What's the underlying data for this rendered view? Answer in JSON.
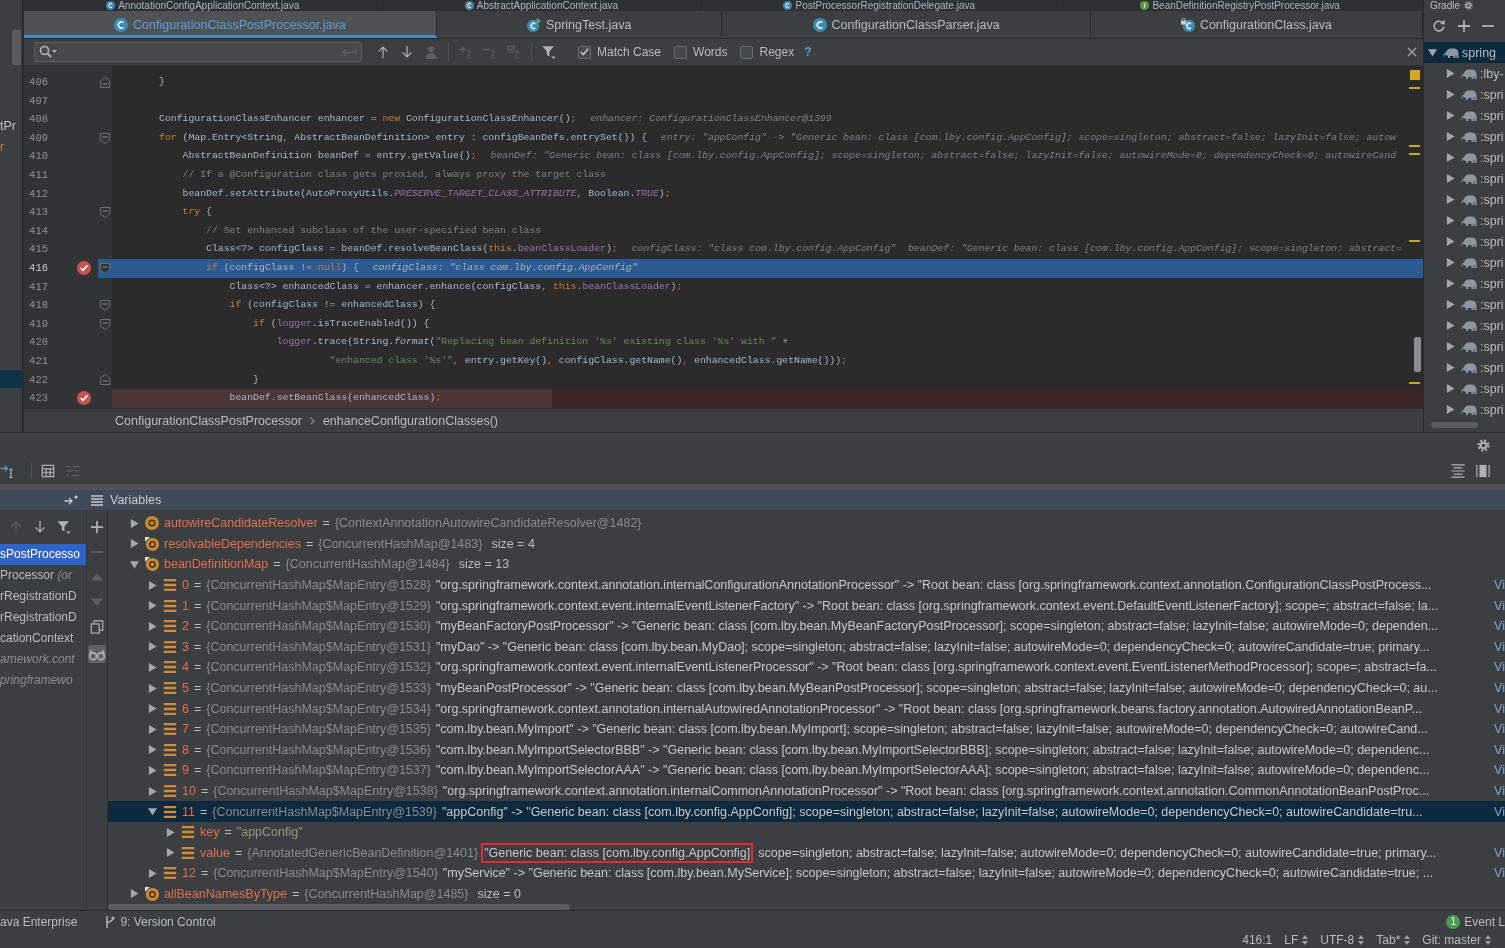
{
  "project_strip": {
    "items": [
      {
        "label": "tPr",
        "color": "#bbbbbb"
      },
      {
        "label": "r",
        "color": "#c47a3c"
      }
    ],
    "selection_visible": true
  },
  "tab_rows": [
    {
      "tabs": [
        {
          "label": "AnnotationConfigApplicationContext.java",
          "kind": "class",
          "selected": false
        },
        {
          "label": "AbstractApplicationContext.java",
          "kind": "abstract_class",
          "selected": false
        },
        {
          "label": "PostProcessorRegistrationDelegate.java",
          "kind": "class",
          "selected": false
        },
        {
          "label": "BeanDefinitionRegistryPostProcessor.java",
          "kind": "interface",
          "selected": false
        }
      ]
    },
    {
      "tabs": [
        {
          "label": "ConfigurationClassPostProcessor.java",
          "kind": "class",
          "selected": true
        },
        {
          "label": "SpringTest.java",
          "kind": "runnable_class",
          "selected": false
        },
        {
          "label": "ConfigurationClassParser.java",
          "kind": "class",
          "selected": false
        },
        {
          "label": "ConfigurationClass.java",
          "kind": "final_class",
          "selected": false
        }
      ]
    }
  ],
  "find_bar": {
    "tools": [
      {
        "kind": "previous",
        "disabled": false
      },
      {
        "kind": "next",
        "disabled": false
      },
      {
        "kind": "person",
        "disabled": true
      },
      {
        "kind": "add_occurrence",
        "disabled": true
      },
      {
        "kind": "remove_occurrence",
        "disabled": true
      },
      {
        "kind": "select_occurrences",
        "disabled": true
      },
      {
        "kind": "filter",
        "disabled": false
      }
    ],
    "options": [
      {
        "label": "Match Case",
        "checked": true
      },
      {
        "label": "Words",
        "checked": false
      },
      {
        "label": "Regex",
        "checked": false
      }
    ],
    "help": "?"
  },
  "editor": {
    "lines": [
      {
        "number": "406",
        "fold": {
          "kind": "end"
        },
        "breakpoint": false,
        "current": false,
        "tokens": [
          {
            "kind": "plain",
            "text": "        }"
          }
        ]
      },
      {
        "number": "407",
        "breakpoint": false,
        "current": false
      },
      {
        "number": "408",
        "breakpoint": false,
        "current": false,
        "tokens": [
          {
            "kind": "plain",
            "text": "        ConfigurationClassEnhancer enhancer = "
          },
          {
            "kind": "keyword",
            "text": "new"
          },
          {
            "kind": "plain",
            "text": " ConfigurationClassEnhancer()"
          },
          {
            "kind": "punct",
            "text": ";"
          }
        ],
        "hint": "enhancer: ConfigurationClassEnhancer@1399"
      },
      {
        "number": "409",
        "fold": {
          "kind": "start"
        },
        "breakpoint": false,
        "current": false,
        "tokens": [
          {
            "kind": "keyword",
            "text": "        for"
          },
          {
            "kind": "plain",
            "text": " (Map.Entry<String"
          },
          {
            "kind": "punct",
            "text": ","
          },
          {
            "kind": "plain",
            "text": " AbstractBeanDefinition> entry : configBeanDefs.entrySet()) {"
          }
        ],
        "hint": "entry: \"appConfig\" -> \"Generic bean: class [com.lby.config.AppConfig]; scope=singleton; abstract=false; lazyInit=false; autow"
      },
      {
        "number": "410",
        "breakpoint": false,
        "current": false,
        "tokens": [
          {
            "kind": "plain",
            "text": "            AbstractBeanDefinition beanDef = entry.getValue()"
          },
          {
            "kind": "punct",
            "text": ";"
          }
        ],
        "hint": "beanDef: \"Generic bean: class [com.lby.config.AppConfig]; scope=singleton; abstract=false; lazyInit=false; autowireMode=0; dependencyCheck=0; autowireCand"
      },
      {
        "number": "411",
        "breakpoint": false,
        "current": false,
        "tokens": [
          {
            "kind": "comment",
            "text": "            // If a @Configuration class gets proxied, always proxy the target class"
          }
        ]
      },
      {
        "number": "412",
        "breakpoint": false,
        "current": false,
        "tokens": [
          {
            "kind": "plain",
            "text": "            beanDef.setAttribute(AutoProxyUtils."
          },
          {
            "kind": "constant",
            "text": "PRESERVE_TARGET_CLASS_ATTRIBUTE"
          },
          {
            "kind": "punct",
            "text": ","
          },
          {
            "kind": "plain",
            "text": " Boolean."
          },
          {
            "kind": "constant",
            "text": "TRUE"
          },
          {
            "kind": "plain",
            "text": ")"
          },
          {
            "kind": "punct",
            "text": ";"
          }
        ]
      },
      {
        "number": "413",
        "fold": {
          "kind": "start"
        },
        "breakpoint": false,
        "current": false,
        "tokens": [
          {
            "kind": "keyword",
            "text": "            try"
          },
          {
            "kind": "plain",
            "text": " {"
          }
        ]
      },
      {
        "number": "414",
        "breakpoint": false,
        "current": false,
        "tokens": [
          {
            "kind": "comment",
            "text": "                // Set enhanced subclass of the user-specified bean class"
          }
        ]
      },
      {
        "number": "415",
        "breakpoint": false,
        "current": false,
        "tokens": [
          {
            "kind": "plain",
            "text": "                Class<?> configClass = beanDef.resolveBeanClass("
          },
          {
            "kind": "keyword",
            "text": "this"
          },
          {
            "kind": "plain",
            "text": "."
          },
          {
            "kind": "field",
            "text": "beanClassLoader"
          },
          {
            "kind": "plain",
            "text": ")"
          },
          {
            "kind": "punct",
            "text": ";"
          }
        ],
        "hint": "configClass: \"class com.lby.config.AppConfig\"  beanDef: \"Generic bean: class [com.lby.config.AppConfig]; scope=singleton; abstract="
      },
      {
        "number": "416",
        "fold": {
          "kind": "start"
        },
        "breakpoint": true,
        "current": true,
        "tokens": [
          {
            "kind": "keyword",
            "text": "                if"
          },
          {
            "kind": "plain",
            "text": " (configClass != "
          },
          {
            "kind": "keyword",
            "text": "null"
          },
          {
            "kind": "plain",
            "text": ") {"
          }
        ],
        "hint": "configClass: \"class com.lby.config.AppConfig\""
      },
      {
        "number": "417",
        "breakpoint": false,
        "current": false,
        "tokens": [
          {
            "kind": "plain",
            "text": "                    Class<?> enhancedClass = enhancer.enhance(configClass"
          },
          {
            "kind": "punct",
            "text": ","
          },
          {
            "kind": "keyword",
            "text": " this"
          },
          {
            "kind": "plain",
            "text": "."
          },
          {
            "kind": "field",
            "text": "beanClassLoader"
          },
          {
            "kind": "plain",
            "text": ")"
          },
          {
            "kind": "punct",
            "text": ";"
          }
        ]
      },
      {
        "number": "418",
        "fold": {
          "kind": "start"
        },
        "breakpoint": false,
        "current": false,
        "tokens": [
          {
            "kind": "keyword",
            "text": "                    if"
          },
          {
            "kind": "plain",
            "text": " (configClass != enhancedClass) {"
          }
        ]
      },
      {
        "number": "419",
        "fold": {
          "kind": "start"
        },
        "breakpoint": false,
        "current": false,
        "tokens": [
          {
            "kind": "keyword",
            "text": "                        if"
          },
          {
            "kind": "plain",
            "text": " ("
          },
          {
            "kind": "field",
            "text": "logger"
          },
          {
            "kind": "plain",
            "text": ".isTraceEnabled()) {"
          }
        ]
      },
      {
        "number": "420",
        "breakpoint": false,
        "current": false,
        "tokens": [
          {
            "kind": "field",
            "text": "                            logger"
          },
          {
            "kind": "plain",
            "text": ".trace(String."
          },
          {
            "kind": "static_method",
            "text": "format"
          },
          {
            "kind": "plain",
            "text": "("
          },
          {
            "kind": "string",
            "text": "\"Replacing bean definition '%s' existing class '%s' with \""
          },
          {
            "kind": "plain",
            "text": " +"
          }
        ]
      },
      {
        "number": "421",
        "breakpoint": false,
        "current": false,
        "tokens": [
          {
            "kind": "string",
            "text": "                                     \"enhanced class '%s'\""
          },
          {
            "kind": "punct",
            "text": ","
          },
          {
            "kind": "plain",
            "text": " entry.getKey()"
          },
          {
            "kind": "punct",
            "text": ","
          },
          {
            "kind": "plain",
            "text": " configClass.getName()"
          },
          {
            "kind": "punct",
            "text": ","
          },
          {
            "kind": "plain",
            "text": " enhancedClass.getName()))"
          },
          {
            "kind": "punct",
            "text": ";"
          }
        ]
      },
      {
        "number": "422",
        "fold": {
          "kind": "end"
        },
        "breakpoint": false,
        "current": false,
        "tokens": [
          {
            "kind": "plain",
            "text": "                        }"
          }
        ]
      },
      {
        "number": "423",
        "breakpoint": true,
        "current": false,
        "tokens": [
          {
            "kind": "plain",
            "text": "                    beanDef.setBeanClass(enhancedClass)"
          },
          {
            "kind": "punct",
            "text": ";"
          }
        ]
      }
    ]
  },
  "breadcrumbs": [
    "ConfigurationClassPostProcessor",
    "enhanceConfigurationClasses()"
  ],
  "gradle": {
    "title": "Gradle",
    "tree": [
      {
        "label": "spring",
        "expanded": true,
        "selected": true,
        "children": [
          {
            "label": ":lby-",
            "expanded": false,
            "selected": false
          },
          {
            "label": ":spri",
            "expanded": false,
            "selected": false
          },
          {
            "label": ":spri",
            "expanded": false,
            "selected": false
          },
          {
            "label": ":spri",
            "expanded": false,
            "selected": false
          },
          {
            "label": ":spri",
            "expanded": false,
            "selected": false
          },
          {
            "label": ":spri",
            "expanded": false,
            "selected": false
          },
          {
            "label": ":spri",
            "expanded": false,
            "selected": false
          },
          {
            "label": ":spri",
            "expanded": false,
            "selected": false
          },
          {
            "label": ":spri",
            "expanded": false,
            "selected": false
          },
          {
            "label": ":spri",
            "expanded": false,
            "selected": false
          },
          {
            "label": ":spri",
            "expanded": false,
            "selected": false
          },
          {
            "label": ":spri",
            "expanded": false,
            "selected": false
          },
          {
            "label": ":spri",
            "expanded": false,
            "selected": false
          },
          {
            "label": ":spri",
            "expanded": false,
            "selected": false
          },
          {
            "label": ":spri",
            "expanded": false,
            "selected": false
          },
          {
            "label": ":spri",
            "expanded": false,
            "selected": false
          },
          {
            "label": ":spri",
            "expanded": false,
            "selected": false
          }
        ]
      }
    ]
  },
  "debug_toolbar": {
    "left": [
      {
        "kind": "run_to_cursor",
        "disabled": false
      },
      {
        "kind": "evaluate",
        "disabled": false
      },
      {
        "kind": "trace",
        "disabled": true
      }
    ],
    "right": [
      {
        "kind": "align",
        "disabled": false
      },
      {
        "kind": "columns",
        "disabled": false
      }
    ]
  },
  "frames": {
    "toolbar": [
      {
        "kind": "up",
        "disabled": true
      },
      {
        "kind": "down",
        "disabled": false
      },
      {
        "kind": "filter",
        "disabled": false
      }
    ],
    "items": [
      {
        "method": "sPostProcesso",
        "selected": true
      },
      {
        "method": "Processor",
        "location": "(or",
        "selected": false
      },
      {
        "method": "rRegistrationD",
        "selected": false
      },
      {
        "method": "rRegistrationD",
        "selected": false
      },
      {
        "method": "cationContext",
        "selected": false
      },
      {
        "location": "amework.cont",
        "selected": false
      },
      {
        "location": "pringframewo",
        "selected": false
      }
    ]
  },
  "side_toolbar": [
    {
      "kind": "add",
      "disabled": false,
      "on": false
    },
    {
      "kind": "remove",
      "disabled": true,
      "on": false
    },
    {
      "kind": "move_up",
      "disabled": true,
      "on": false
    },
    {
      "kind": "move_down",
      "disabled": true,
      "on": false
    },
    {
      "kind": "copy",
      "disabled": false,
      "on": false
    },
    {
      "kind": "glasses",
      "disabled": false,
      "on": true
    }
  ],
  "variables": {
    "title": "Variables",
    "tree": [
      {
        "name": "autowireCandidateResolver",
        "kind": "field",
        "equals": "=",
        "ref": "{ContextAnnotationAutowireCandidateResolver@1482}",
        "expanded": false,
        "selected": false
      },
      {
        "name": "resolvableDependencies",
        "kind": "final_field",
        "equals": "=",
        "ref": "{ConcurrentHashMap@1483}",
        "size": "size = 4",
        "expanded": false,
        "selected": false
      },
      {
        "name": "beanDefinitionMap",
        "kind": "final_field",
        "equals": "=",
        "ref": "{ConcurrentHashMap@1484}",
        "size": "size = 13",
        "expanded": true,
        "selected": false,
        "children": [
          {
            "name": "0",
            "kind": "entry",
            "equals": "=",
            "ref": "{ConcurrentHashMap$MapEntry@1528}",
            "value": "\"org.springframework.context.annotation.internalConfigurationAnnotationProcessor\" -> \"Root bean: class [org.springframework.context.annotation.ConfigurationClassPostProcess...",
            "link": "Vi",
            "expanded": false,
            "selected": false
          },
          {
            "name": "1",
            "kind": "entry",
            "equals": "=",
            "ref": "{ConcurrentHashMap$MapEntry@1529}",
            "value": "\"org.springframework.context.event.internalEventListenerFactory\" -> \"Root bean: class [org.springframework.context.event.DefaultEventListenerFactory]; scope=; abstract=false; la...",
            "link": "Vi",
            "expanded": false,
            "selected": false
          },
          {
            "name": "2",
            "kind": "entry",
            "equals": "=",
            "ref": "{ConcurrentHashMap$MapEntry@1530}",
            "value": "\"myBeanFactoryPostProcessor\" -> \"Generic bean: class [com.lby.bean.MyBeanFactoryPostProcessor]; scope=singleton; abstract=false; lazyInit=false; autowireMode=0; dependen...",
            "link": "Vi",
            "expanded": false,
            "selected": false
          },
          {
            "name": "3",
            "kind": "entry",
            "equals": "=",
            "ref": "{ConcurrentHashMap$MapEntry@1531}",
            "value": "\"myDao\" -> \"Generic bean: class [com.lby.bean.MyDao]; scope=singleton; abstract=false; lazyInit=false; autowireMode=0; dependencyCheck=0; autowireCandidate=true; primary...",
            "link": "Vi",
            "expanded": false,
            "selected": false
          },
          {
            "name": "4",
            "kind": "entry",
            "equals": "=",
            "ref": "{ConcurrentHashMap$MapEntry@1532}",
            "value": "\"org.springframework.context.event.internalEventListenerProcessor\" -> \"Root bean: class [org.springframework.context.event.EventListenerMethodProcessor]; scope=; abstract=fa...",
            "link": "Vi",
            "expanded": false,
            "selected": false
          },
          {
            "name": "5",
            "kind": "entry",
            "equals": "=",
            "ref": "{ConcurrentHashMap$MapEntry@1533}",
            "value": "\"myBeanPostProcessor\" -> \"Generic bean: class [com.lby.bean.MyBeanPostProcessor]; scope=singleton; abstract=false; lazyInit=false; autowireMode=0; dependencyCheck=0; au...",
            "link": "Vi",
            "expanded": false,
            "selected": false
          },
          {
            "name": "6",
            "kind": "entry",
            "equals": "=",
            "ref": "{ConcurrentHashMap$MapEntry@1534}",
            "value": "\"org.springframework.context.annotation.internalAutowiredAnnotationProcessor\" -> \"Root bean: class [org.springframework.beans.factory.annotation.AutowiredAnnotationBeanP...",
            "link": "Vi",
            "expanded": false,
            "selected": false
          },
          {
            "name": "7",
            "kind": "entry",
            "equals": "=",
            "ref": "{ConcurrentHashMap$MapEntry@1535}",
            "value": "\"com.lby.bean.MyImport\" -> \"Generic bean: class [com.lby.bean.MyImport]; scope=singleton; abstract=false; lazyInit=false; autowireMode=0; dependencyCheck=0; autowireCand...",
            "link": "Vi",
            "expanded": false,
            "selected": false
          },
          {
            "name": "8",
            "kind": "entry",
            "equals": "=",
            "ref": "{ConcurrentHashMap$MapEntry@1536}",
            "value": "\"com.lby.bean.MyImportSelectorBBB\" -> \"Generic bean: class [com.lby.bean.MyImportSelectorBBB]; scope=singleton; abstract=false; lazyInit=false; autowireMode=0; dependenc...",
            "link": "Vi",
            "expanded": false,
            "selected": false
          },
          {
            "name": "9",
            "kind": "entry",
            "equals": "=",
            "ref": "{ConcurrentHashMap$MapEntry@1537}",
            "value": "\"com.lby.bean.MyImportSelectorAAA\" -> \"Generic bean: class [com.lby.bean.MyImportSelectorAAA]; scope=singleton; abstract=false; lazyInit=false; autowireMode=0; dependenc...",
            "link": "Vi",
            "expanded": false,
            "selected": false
          },
          {
            "name": "10",
            "kind": "entry",
            "equals": "=",
            "ref": "{ConcurrentHashMap$MapEntry@1538}",
            "value": "\"org.springframework.context.annotation.internalCommonAnnotationProcessor\" -> \"Root bean: class [org.springframework.context.annotation.CommonAnnotationBeanPostProc...",
            "link": "Vi",
            "expanded": false,
            "selected": false
          },
          {
            "name": "11",
            "kind": "entry",
            "equals": "=",
            "ref": "{ConcurrentHashMap$MapEntry@1539}",
            "value": "\"appConfig\" -> \"Generic bean: class [com.lby.config.AppConfig]; scope=singleton; abstract=false; lazyInit=false; autowireMode=0; dependencyCheck=0; autowireCandidate=tru...",
            "link": "Vi",
            "expanded": true,
            "selected": true,
            "children": [
              {
                "name": "key",
                "kind": "entry",
                "equals": "=",
                "string_value": "\"appConfig\"",
                "expanded": false,
                "selected": false
              },
              {
                "name": "value",
                "kind": "entry",
                "equals": "=",
                "ref": "{AnnotatedGenericBeanDefinition@1401}",
                "boxed_value": "\"Generic bean: class [com.lby.config.AppConfig]",
                "value": "scope=singleton; abstract=false; lazyInit=false; autowireMode=0; dependencyCheck=0; autowireCandidate=true; primary...",
                "link": "Vi",
                "expanded": false,
                "selected": false
              }
            ]
          },
          {
            "name": "12",
            "kind": "entry",
            "equals": "=",
            "ref": "{ConcurrentHashMap$MapEntry@1540}",
            "value": "\"myService\" -> \"Generic bean: class [com.lby.bean.MyService]; scope=singleton; abstract=false; lazyInit=false; autowireMode=0; dependencyCheck=0; autowireCandidate=true; ...",
            "link": "Vi",
            "expanded": false,
            "selected": false
          }
        ]
      },
      {
        "name": "allBeanNamesByType",
        "kind": "final_field",
        "equals": "=",
        "ref": "{ConcurrentHashMap@1485}",
        "size": "size = 0",
        "expanded": false,
        "selected": false
      }
    ]
  },
  "tool_window_bar": {
    "left": [
      {
        "label": "ava Enterprise",
        "kind": "plain"
      },
      {
        "label": "9: Version Control",
        "kind": "vcs"
      }
    ],
    "event_log": {
      "count": "1",
      "label": "Event L"
    }
  },
  "status_bar": [
    {
      "text": "416:1",
      "chooser": false
    },
    {
      "text": "LF",
      "chooser": true
    },
    {
      "text": "UTF-8",
      "chooser": true
    },
    {
      "text": "Tab*",
      "chooser": true
    },
    {
      "text": "Git: master",
      "chooser": true
    }
  ]
}
